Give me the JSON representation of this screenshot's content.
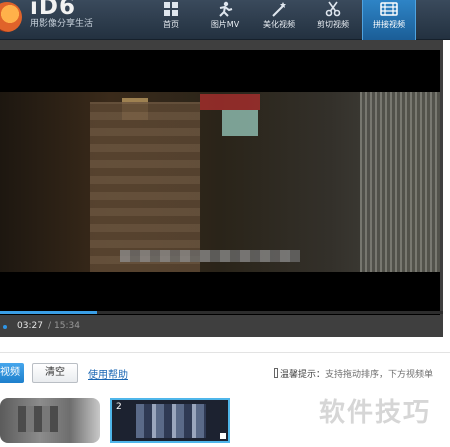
{
  "app": {
    "logo_text": "iD6",
    "slogan": "用影像分享生活"
  },
  "nav": {
    "items": [
      {
        "label": "首页",
        "icon": "grid-icon",
        "active": false
      },
      {
        "label": "图片MV",
        "icon": "figure-icon",
        "active": false
      },
      {
        "label": "美化视频",
        "icon": "wand-icon",
        "active": false
      },
      {
        "label": "剪切视频",
        "icon": "scissors-icon",
        "active": false
      },
      {
        "label": "拼接视频",
        "icon": "film-icon",
        "active": true
      }
    ]
  },
  "player": {
    "current_time": "03:27",
    "separator": "/",
    "total_time": "15:34",
    "progress_percent": 22
  },
  "toolbar": {
    "merge_label": "视频",
    "clear_label": "清空",
    "help_label": "使用帮助",
    "tip_prefix": "温馨提示：",
    "tip_text": "支持拖动排序，下方视频单"
  },
  "clips": [
    {
      "index": ""
    },
    {
      "index": "2"
    }
  ],
  "watermark": "软件技巧",
  "colors": {
    "accent": "#1d7fcc",
    "header": "#2b3a4b",
    "player_bg": "#3f3f3f"
  }
}
